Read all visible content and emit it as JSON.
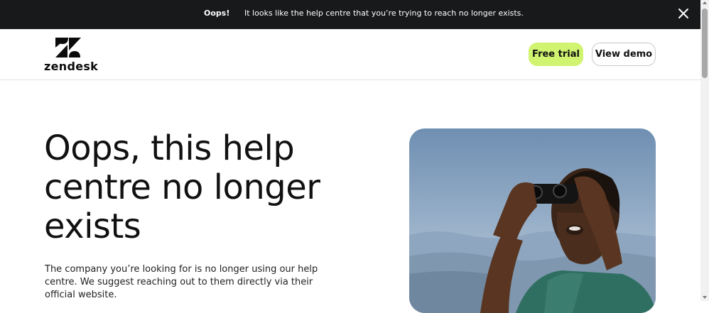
{
  "banner": {
    "title": "Oops!",
    "message": "It looks like the help centre that you’re trying to reach no longer exists.",
    "close_icon": "close-icon"
  },
  "header": {
    "logo_text": "zendesk",
    "logo_icon": "zendesk-logo-icon",
    "free_trial_label": "Free trial",
    "view_demo_label": "View demo"
  },
  "main": {
    "headline": "Oops, this help centre no longer exists",
    "description": "The company you’re looking for is no longer using our help centre. We suggest reaching out to them directly via their official website."
  },
  "colors": {
    "banner_bg": "#17191a",
    "accent": "#d1f470",
    "text": "#111111"
  }
}
